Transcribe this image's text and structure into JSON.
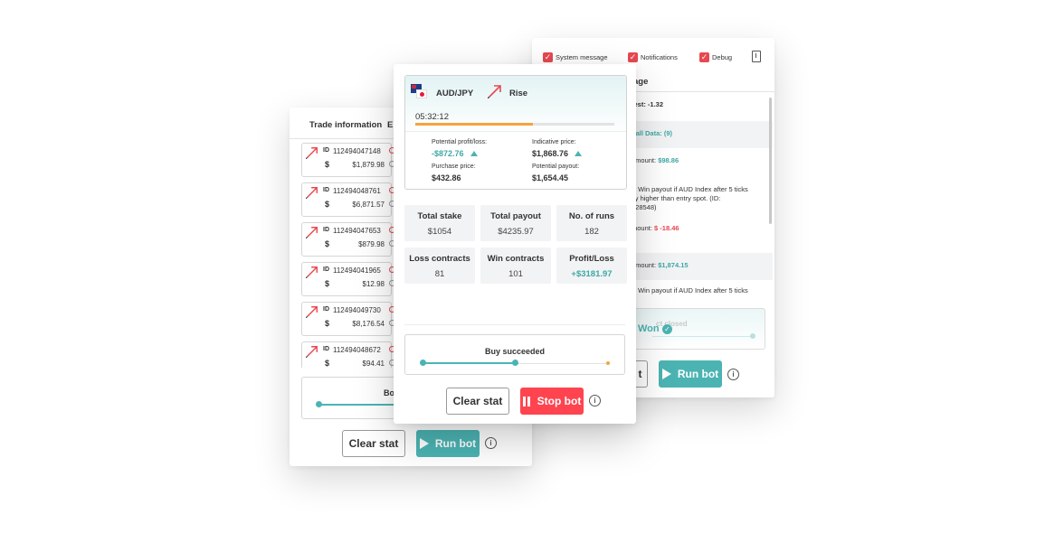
{
  "left_panel": {
    "header": {
      "trade_info": "Trade information",
      "entry_partial": "En"
    },
    "trades": [
      {
        "id_label": "ID",
        "id": "112494047148",
        "currency": "$",
        "amount": "$1,879.98"
      },
      {
        "id_label": "ID",
        "id": "112494048761",
        "currency": "$",
        "amount": "$6,871.57"
      },
      {
        "id_label": "ID",
        "id": "112494047653",
        "currency": "$",
        "amount": "$879.98"
      },
      {
        "id_label": "ID",
        "id": "112494041965",
        "currency": "$",
        "amount": "$12.98"
      },
      {
        "id_label": "ID",
        "id": "112494049730",
        "currency": "$",
        "amount": "$8,176.54"
      },
      {
        "id_label": "ID",
        "id": "112494048672",
        "currency": "$",
        "amount": "$94.41"
      }
    ],
    "status_partial": "Bo",
    "buttons": {
      "clear": "Clear stat",
      "run": "Run bot"
    }
  },
  "right_panel": {
    "filters": [
      {
        "label": "System message",
        "checked": true
      },
      {
        "label": "Notifications",
        "checked": true
      },
      {
        "label": "Debug",
        "checked": true
      }
    ],
    "header_partial": "age",
    "journal": [
      {
        "prefix": "test: ",
        "value": "-1.32",
        "style": "bold"
      },
      {
        "prefix": "",
        "value": "t all Data: (9)",
        "style": "teal"
      },
      {
        "prefix": "amount: ",
        "value": "$98.86",
        "style": "teal"
      },
      {
        "prefix": "t: ",
        "text": "Win payout if AUD Index after 5 ticks",
        "text2": "tly higher than entry spot. (ID:",
        "text3": "528548)"
      },
      {
        "prefix": "mount: ",
        "value": "$ -18.46",
        "style": "red"
      },
      {
        "prefix": "amount: ",
        "value": "$1,874.15",
        "style": "teal"
      },
      {
        "prefix": "t: ",
        "text": "Win payout if AUD Index after 5 ticks"
      }
    ],
    "won_label": "Won",
    "closed_label": "ct closed",
    "buttons": {
      "clear_partial": "t",
      "run": "Run bot"
    }
  },
  "center_panel": {
    "asset": "AUD/JPY",
    "direction": "Rise",
    "timer": "05:32:12",
    "progress": 0.59,
    "potential_pl_label": "Potential profit/loss:",
    "potential_pl_value": "-$872.76",
    "indicative_label": "Indicative price:",
    "indicative_value": "$1,868.76",
    "purchase_label": "Purchase price:",
    "purchase_value": "$432.86",
    "payout_label": "Potential payout:",
    "payout_value": "$1,654.45",
    "stats": [
      {
        "title": "Total stake",
        "value": "$1054"
      },
      {
        "title": "Total payout",
        "value": "$4235.97"
      },
      {
        "title": "No. of runs",
        "value": "182"
      },
      {
        "title": "Loss contracts",
        "value": "81"
      },
      {
        "title": "Win contracts",
        "value": "101"
      },
      {
        "title": "Profit/Loss",
        "value": "+$3181.97"
      }
    ],
    "status": "Buy succeeded",
    "buttons": {
      "clear": "Clear stat",
      "stop": "Stop bot"
    }
  },
  "colors": {
    "teal": "#4bb4b3",
    "red": "#ff444f",
    "orange": "#f5a33d"
  }
}
